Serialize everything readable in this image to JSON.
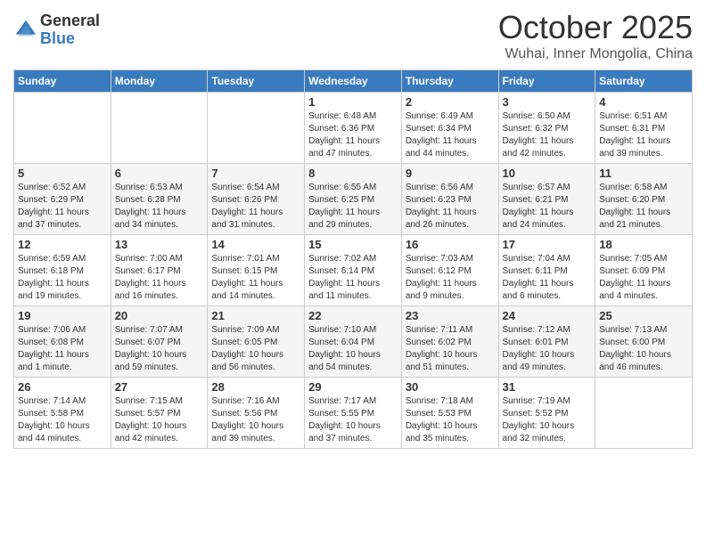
{
  "header": {
    "logo_general": "General",
    "logo_blue": "Blue",
    "month": "October 2025",
    "location": "Wuhai, Inner Mongolia, China"
  },
  "days_of_week": [
    "Sunday",
    "Monday",
    "Tuesday",
    "Wednesday",
    "Thursday",
    "Friday",
    "Saturday"
  ],
  "weeks": [
    {
      "cells": [
        {
          "day": null,
          "info": ""
        },
        {
          "day": null,
          "info": ""
        },
        {
          "day": null,
          "info": ""
        },
        {
          "day": "1",
          "info": "Sunrise: 6:48 AM\nSunset: 6:36 PM\nDaylight: 11 hours\nand 47 minutes."
        },
        {
          "day": "2",
          "info": "Sunrise: 6:49 AM\nSunset: 6:34 PM\nDaylight: 11 hours\nand 44 minutes."
        },
        {
          "day": "3",
          "info": "Sunrise: 6:50 AM\nSunset: 6:32 PM\nDaylight: 11 hours\nand 42 minutes."
        },
        {
          "day": "4",
          "info": "Sunrise: 6:51 AM\nSunset: 6:31 PM\nDaylight: 11 hours\nand 39 minutes."
        }
      ]
    },
    {
      "cells": [
        {
          "day": "5",
          "info": "Sunrise: 6:52 AM\nSunset: 6:29 PM\nDaylight: 11 hours\nand 37 minutes."
        },
        {
          "day": "6",
          "info": "Sunrise: 6:53 AM\nSunset: 6:28 PM\nDaylight: 11 hours\nand 34 minutes."
        },
        {
          "day": "7",
          "info": "Sunrise: 6:54 AM\nSunset: 6:26 PM\nDaylight: 11 hours\nand 31 minutes."
        },
        {
          "day": "8",
          "info": "Sunrise: 6:55 AM\nSunset: 6:25 PM\nDaylight: 11 hours\nand 29 minutes."
        },
        {
          "day": "9",
          "info": "Sunrise: 6:56 AM\nSunset: 6:23 PM\nDaylight: 11 hours\nand 26 minutes."
        },
        {
          "day": "10",
          "info": "Sunrise: 6:57 AM\nSunset: 6:21 PM\nDaylight: 11 hours\nand 24 minutes."
        },
        {
          "day": "11",
          "info": "Sunrise: 6:58 AM\nSunset: 6:20 PM\nDaylight: 11 hours\nand 21 minutes."
        }
      ]
    },
    {
      "cells": [
        {
          "day": "12",
          "info": "Sunrise: 6:59 AM\nSunset: 6:18 PM\nDaylight: 11 hours\nand 19 minutes."
        },
        {
          "day": "13",
          "info": "Sunrise: 7:00 AM\nSunset: 6:17 PM\nDaylight: 11 hours\nand 16 minutes."
        },
        {
          "day": "14",
          "info": "Sunrise: 7:01 AM\nSunset: 6:15 PM\nDaylight: 11 hours\nand 14 minutes."
        },
        {
          "day": "15",
          "info": "Sunrise: 7:02 AM\nSunset: 6:14 PM\nDaylight: 11 hours\nand 11 minutes."
        },
        {
          "day": "16",
          "info": "Sunrise: 7:03 AM\nSunset: 6:12 PM\nDaylight: 11 hours\nand 9 minutes."
        },
        {
          "day": "17",
          "info": "Sunrise: 7:04 AM\nSunset: 6:11 PM\nDaylight: 11 hours\nand 6 minutes."
        },
        {
          "day": "18",
          "info": "Sunrise: 7:05 AM\nSunset: 6:09 PM\nDaylight: 11 hours\nand 4 minutes."
        }
      ]
    },
    {
      "cells": [
        {
          "day": "19",
          "info": "Sunrise: 7:06 AM\nSunset: 6:08 PM\nDaylight: 11 hours\nand 1 minute."
        },
        {
          "day": "20",
          "info": "Sunrise: 7:07 AM\nSunset: 6:07 PM\nDaylight: 10 hours\nand 59 minutes."
        },
        {
          "day": "21",
          "info": "Sunrise: 7:09 AM\nSunset: 6:05 PM\nDaylight: 10 hours\nand 56 minutes."
        },
        {
          "day": "22",
          "info": "Sunrise: 7:10 AM\nSunset: 6:04 PM\nDaylight: 10 hours\nand 54 minutes."
        },
        {
          "day": "23",
          "info": "Sunrise: 7:11 AM\nSunset: 6:02 PM\nDaylight: 10 hours\nand 51 minutes."
        },
        {
          "day": "24",
          "info": "Sunrise: 7:12 AM\nSunset: 6:01 PM\nDaylight: 10 hours\nand 49 minutes."
        },
        {
          "day": "25",
          "info": "Sunrise: 7:13 AM\nSunset: 6:00 PM\nDaylight: 10 hours\nand 46 minutes."
        }
      ]
    },
    {
      "cells": [
        {
          "day": "26",
          "info": "Sunrise: 7:14 AM\nSunset: 5:58 PM\nDaylight: 10 hours\nand 44 minutes."
        },
        {
          "day": "27",
          "info": "Sunrise: 7:15 AM\nSunset: 5:57 PM\nDaylight: 10 hours\nand 42 minutes."
        },
        {
          "day": "28",
          "info": "Sunrise: 7:16 AM\nSunset: 5:56 PM\nDaylight: 10 hours\nand 39 minutes."
        },
        {
          "day": "29",
          "info": "Sunrise: 7:17 AM\nSunset: 5:55 PM\nDaylight: 10 hours\nand 37 minutes."
        },
        {
          "day": "30",
          "info": "Sunrise: 7:18 AM\nSunset: 5:53 PM\nDaylight: 10 hours\nand 35 minutes."
        },
        {
          "day": "31",
          "info": "Sunrise: 7:19 AM\nSunset: 5:52 PM\nDaylight: 10 hours\nand 32 minutes."
        },
        {
          "day": null,
          "info": ""
        }
      ]
    }
  ]
}
